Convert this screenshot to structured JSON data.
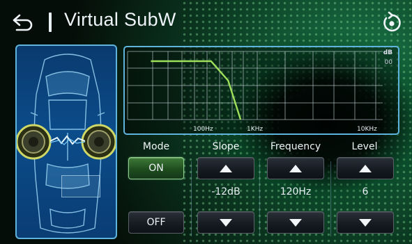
{
  "header": {
    "title": "Virtual SubW",
    "back_icon": "back-arrow-icon",
    "reset_icon": "reset-icon"
  },
  "graph": {
    "y_unit": "dB",
    "y_value": "00",
    "x_ticks": [
      "100Hz",
      "1KHz",
      "10KHz"
    ],
    "grid": true
  },
  "chart_data": {
    "type": "line",
    "title": "",
    "ylabel": "dB",
    "x_scale": "log",
    "x_ticks": [
      "100Hz",
      "1KHz",
      "10KHz"
    ],
    "series": [
      {
        "x": [
          20,
          60,
          120,
          200,
          290
        ],
        "y": [
          0,
          0,
          0,
          -8,
          -24
        ]
      }
    ],
    "ylim": [
      -24,
      0
    ],
    "grid": true
  },
  "controls": {
    "mode": {
      "label": "Mode",
      "on_label": "ON",
      "off_label": "OFF",
      "selected": "ON"
    },
    "slope": {
      "label": "Slope",
      "value": "-12dB"
    },
    "frequency": {
      "label": "Frequency",
      "value": "120Hz"
    },
    "level": {
      "label": "Level",
      "value": "6"
    }
  },
  "colors": {
    "accent_border": "#5fb4de",
    "curve": "#9fe05a",
    "on_button": "#3f7a3a"
  }
}
